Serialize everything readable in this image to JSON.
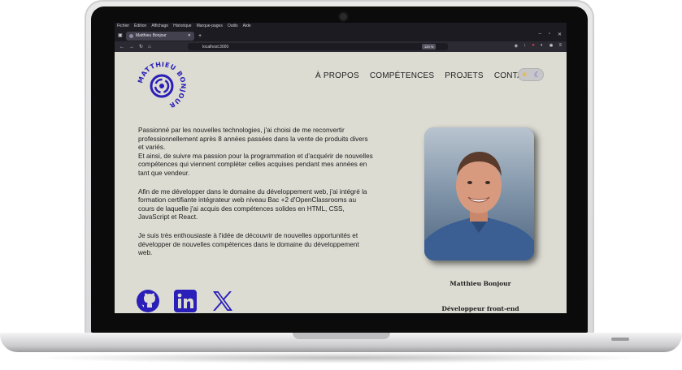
{
  "browser": {
    "menu": [
      "Fichier",
      "Édition",
      "Affichage",
      "Historique",
      "Marque-pages",
      "Outils",
      "Aide"
    ],
    "tab_title": "Matthieu Bonjour",
    "url": "localhost:3000",
    "zoom": "120 %"
  },
  "site": {
    "logo_text": "MATTHIEU BONJOUR",
    "nav": [
      "À PROPOS",
      "COMPÉTENCES",
      "PROJETS",
      "CONTACT"
    ],
    "theme_toggle": {
      "light_icon": "sun-icon",
      "dark_icon": "moon-icon"
    },
    "bio": [
      "Passionné par les nouvelles technologies, j'ai choisi de me reconvertir professionnellement après 8 années passées dans la vente de produits divers et variés.\nEt ainsi, de suivre ma passion pour la programmation et d'acquérir de nouvelles compétences qui viennent compléter celles acquises pendant mes années en tant que vendeur.",
      "Afin de me développer dans le domaine du développement web, j'ai intégré la formation certifiante intégrateur web niveau Bac +2 d'OpenClassrooms au cours de laquelle j'ai acquis des compétences solides en HTML, CSS, JavaScript et React.",
      "Je suis très enthousiaste à l'idée de découvrir de nouvelles opportunités et développer de nouvelles compétences dans le domaine du développement web."
    ],
    "socials": [
      "github-icon",
      "linkedin-icon",
      "x-icon"
    ],
    "person_name": "Matthieu Bonjour",
    "person_role": "Développeur front-end"
  },
  "colors": {
    "accent": "#2a1fb8",
    "page_bg": "#dcdcd3"
  }
}
